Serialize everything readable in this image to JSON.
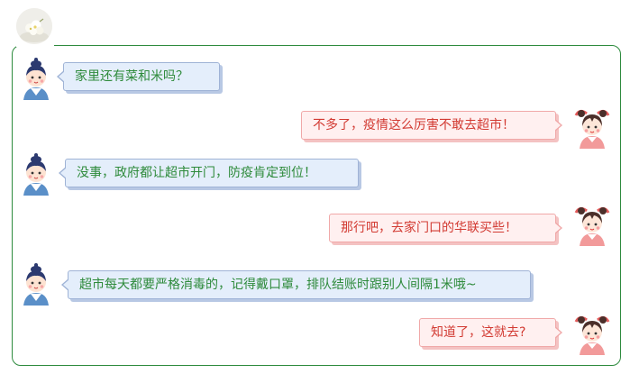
{
  "avatar_top": {
    "icon": "flower-photo-icon"
  },
  "colors": {
    "frame_border": "#2e8b3e",
    "boy_bubble_bg": "#e4eefb",
    "boy_bubble_border": "#9fb3d6",
    "boy_text": "#2d8a3a",
    "girl_bubble_bg": "#fff0f0",
    "girl_bubble_border": "#f0a8a8",
    "girl_text": "#d23a32"
  },
  "messages": [
    {
      "speaker": "boy",
      "text": "家里还有菜和米吗？"
    },
    {
      "speaker": "girl",
      "text": "不多了，疫情这么厉害不敢去超市！"
    },
    {
      "speaker": "boy",
      "text": "没事，政府都让超市开门，防疫肯定到位！"
    },
    {
      "speaker": "girl",
      "text": "那行吧，去家门口的华联买些！"
    },
    {
      "speaker": "boy",
      "text": "超市每天都要严格消毒的，记得戴口罩，排队结账时跟别人间隔1米哦~"
    },
    {
      "speaker": "girl",
      "text": "知道了，这就去?"
    }
  ]
}
